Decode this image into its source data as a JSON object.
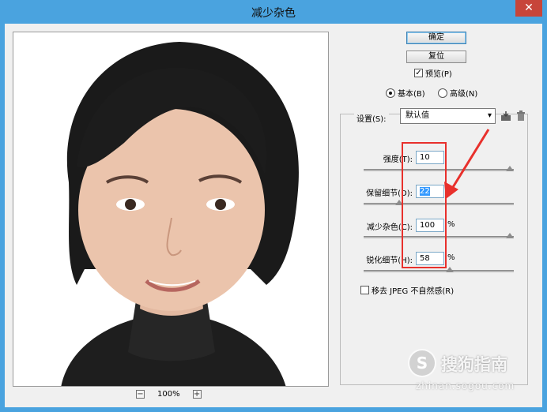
{
  "window": {
    "title": "减少杂色",
    "close_glyph": "✕"
  },
  "preview": {
    "zoom_out_glyph": "−",
    "zoom_in_glyph": "+",
    "zoom_level": "100%"
  },
  "buttons": {
    "ok": "确定",
    "reset": "复位"
  },
  "preview_toggle": {
    "label": "预览(P)",
    "checked": true,
    "check_glyph": "✓"
  },
  "mode": {
    "basic": "基本(B)",
    "advanced": "高级(N)",
    "selected": "basic"
  },
  "settings": {
    "label": "设置(S):",
    "value": "默认值",
    "save_icon": "save-settings-icon",
    "delete_icon": "trash-icon"
  },
  "params": [
    {
      "label": "强度(T):",
      "value": "10",
      "unit": "",
      "level": 1.0
    },
    {
      "label": "保留细节(D):",
      "value": "22",
      "unit": "%",
      "level": 0.22
    },
    {
      "label": "减少杂色(C):",
      "value": "100",
      "unit": "%",
      "level": 1.0
    },
    {
      "label": "锐化细节(H):",
      "value": "58",
      "unit": "%",
      "level": 0.58
    }
  ],
  "jpeg_artifact": {
    "label": "移去 JPEG 不自然感(R)",
    "checked": false
  },
  "watermark": {
    "logo_glyph": "S",
    "brand": "搜狗指南",
    "url": "zhinan.sogou.com"
  },
  "colors": {
    "titlebar": "#4aa3df",
    "annotation": "#e8302c",
    "selection": "#3399ff"
  }
}
